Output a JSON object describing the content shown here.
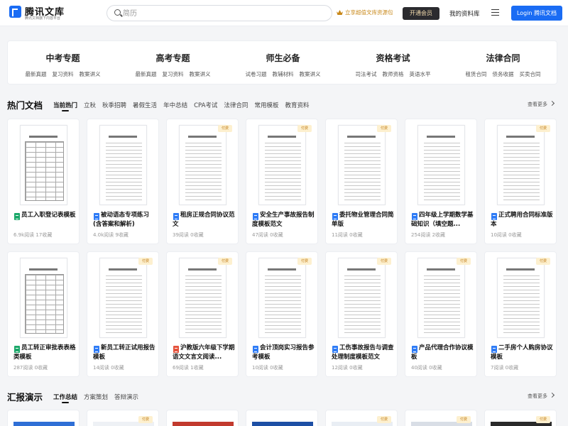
{
  "header": {
    "logo_title": "腾讯文库",
    "logo_subtitle": "腾讯文档旗下内容平台",
    "search_placeholder": "简历",
    "promo_text": "立享超值文库资源包",
    "vip_button": "开通会员",
    "my_library": "我的资料库",
    "login_button": "Login 腾讯文档"
  },
  "categories": [
    {
      "title": "中考专题",
      "links": [
        "最新真题",
        "复习资料",
        "教案讲义"
      ]
    },
    {
      "title": "高考专题",
      "links": [
        "最新真题",
        "复习资料",
        "教案讲义"
      ]
    },
    {
      "title": "师生必备",
      "links": [
        "试卷习题",
        "教辅材料",
        "教案讲义"
      ]
    },
    {
      "title": "资格考试",
      "links": [
        "司法考试",
        "教师资格",
        "英语水平"
      ]
    },
    {
      "title": "法律合同",
      "links": [
        "租赁合同",
        "债务收据",
        "买卖合同"
      ]
    }
  ],
  "hot": {
    "title": "热门文档",
    "tabs": [
      "当前热门",
      "立秋",
      "秋季招聘",
      "暑假生活",
      "年中总结",
      "CPA考试",
      "法律合同",
      "常用模板",
      "教育资料"
    ],
    "more": "查看更多",
    "paid_label": "付费",
    "docs": [
      {
        "title": "员工入职登记表模板",
        "meta": "6.9k阅读 17收藏",
        "type": "excel",
        "paid": false,
        "thumb": "form"
      },
      {
        "title": "被动语态专项练习(含答案和解析)",
        "meta": "4.0k阅读 9收藏",
        "type": "word",
        "paid": false,
        "thumb": "text"
      },
      {
        "title": "租房正规合同协议范文",
        "meta": "39阅读 0收藏",
        "type": "word",
        "paid": true,
        "thumb": "text"
      },
      {
        "title": "安全生产事故报告制度模板范文",
        "meta": "47阅读 0收藏",
        "type": "word",
        "paid": true,
        "thumb": "text"
      },
      {
        "title": "委托物业管理合同简单版",
        "meta": "11阅读 0收藏",
        "type": "word",
        "paid": true,
        "thumb": "text"
      },
      {
        "title": "四年级上学期数学基础知识（填空题...",
        "meta": "254阅读 2收藏",
        "type": "word",
        "paid": false,
        "thumb": "text"
      },
      {
        "title": "正式聘用合同标准版本",
        "meta": "10阅读 0收藏",
        "type": "word",
        "paid": true,
        "thumb": "text"
      },
      {
        "title": "员工转正审批表表格类模板",
        "meta": "287阅读 0收藏",
        "type": "excel",
        "paid": false,
        "thumb": "form"
      },
      {
        "title": "新员工转正试用报告模板",
        "meta": "14阅读 0收藏",
        "type": "word",
        "paid": true,
        "thumb": "text"
      },
      {
        "title": "沪教版六年级下学期语文文言文阅读...",
        "meta": "69阅读 1收藏",
        "type": "pdf",
        "paid": true,
        "thumb": "text"
      },
      {
        "title": "会计顶岗实习报告参考模板",
        "meta": "10阅读 0收藏",
        "type": "word",
        "paid": true,
        "thumb": "text"
      },
      {
        "title": "工伤事故报告与调查处理制度模板范文",
        "meta": "12阅读 0收藏",
        "type": "word",
        "paid": true,
        "thumb": "text"
      },
      {
        "title": "产品代理合作协议模板",
        "meta": "40阅读 0收藏",
        "type": "word",
        "paid": true,
        "thumb": "text"
      },
      {
        "title": "二手房个人购房协议模板",
        "meta": "7阅读 0收藏",
        "type": "word",
        "paid": true,
        "thumb": "text"
      }
    ]
  },
  "report": {
    "title": "汇报演示",
    "tabs": [
      "工作总结",
      "方案策划",
      "答辩演示"
    ],
    "more": "查看更多",
    "paid_label": "付费",
    "cards": [
      {
        "paid": false,
        "color": "#2f6fd6"
      },
      {
        "paid": true,
        "color": "#eef1f5"
      },
      {
        "paid": false,
        "color": "#c23a2e"
      },
      {
        "paid": false,
        "color": "#1d4fa5"
      },
      {
        "paid": true,
        "color": "#e9eef4"
      },
      {
        "paid": true,
        "color": "#d9dee6"
      },
      {
        "paid": true,
        "color": "#2a2a2a"
      }
    ]
  }
}
